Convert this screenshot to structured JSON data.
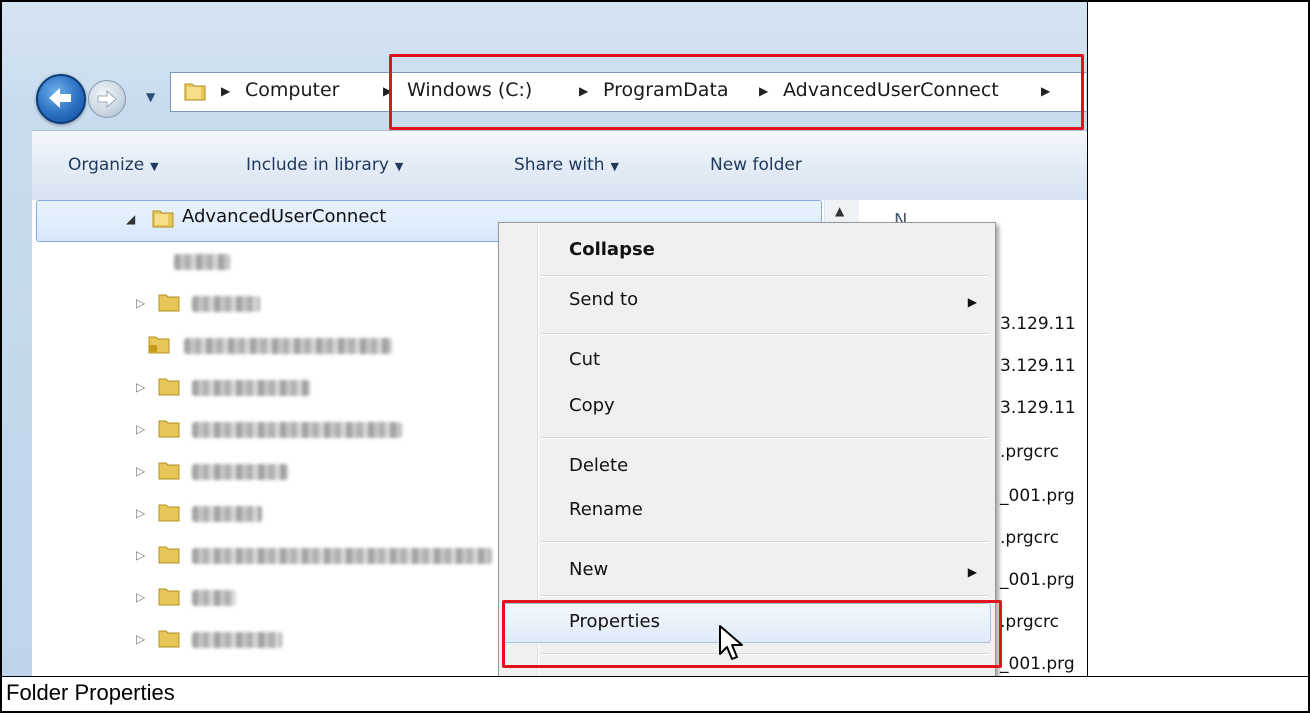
{
  "breadcrumb": {
    "items": [
      "Computer",
      "Windows (C:)",
      "ProgramData",
      "AdvancedUserConnect"
    ]
  },
  "toolbar": {
    "organize": "Organize",
    "include_in_library": "Include in library",
    "share_with": "Share with",
    "new_folder": "New folder"
  },
  "tree": {
    "selected_folder": "AdvancedUserConnect"
  },
  "file_list": {
    "column_header": "N",
    "items": [
      "3.129.11",
      "3.129.11",
      "3.129.11",
      ".prgcrc",
      "_001.prg",
      ".prgcrc",
      "_001.prg",
      ".prgcrc",
      "_001.prg"
    ]
  },
  "context_menu": {
    "collapse": "Collapse",
    "send_to": "Send to",
    "cut": "Cut",
    "copy": "Copy",
    "delete": "Delete",
    "rename": "Rename",
    "new": "New",
    "properties": "Properties"
  },
  "caption": "Folder Properties",
  "colors": {
    "highlight_box": "#e0141c",
    "toolbar_text": "#1e395b"
  }
}
